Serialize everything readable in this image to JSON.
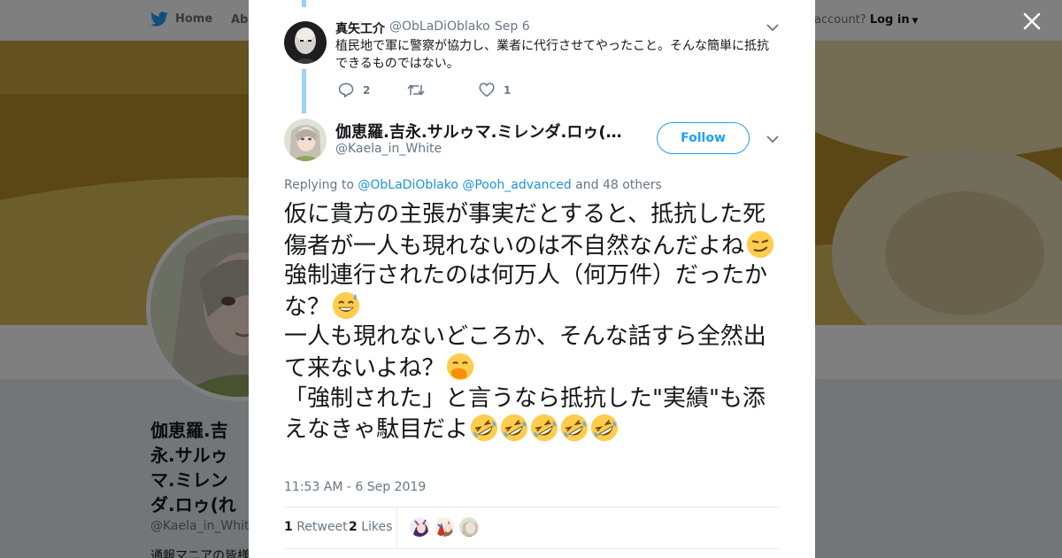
{
  "nav": {
    "home_label": "Home",
    "about_label": "Abo",
    "account_text": "account?",
    "login_label": "Log in"
  },
  "profile": {
    "name": "伽恵羅.吉永.サルゥマ.ミレンダ.ロゥ(れミ)☯お肉美透(CV:小清水",
    "handle": "@Kaela_in_White",
    "bio_snippet": "通報マニアの皆様"
  },
  "parent_tweet": {
    "name": "真矢工介",
    "handle": "@ObLaDiOblako",
    "date": "· Sep 6",
    "text": "植民地で軍に警察が協力し、業者に代行させてやったこと。そんな簡単に抵抗できるものではない。",
    "reply_count": "2",
    "retweet_count": "",
    "like_count": "1"
  },
  "main_tweet": {
    "name": "伽恵羅.吉永.サルゥマ.ミレンダ.ロゥ(…",
    "handle": "@Kaela_in_White",
    "follow_label": "Follow",
    "replying_prefix": "Replying to",
    "replying_user1": "@ObLaDiOblako",
    "replying_user2": "@Pooh_advanced",
    "replying_suffix": "and 48 others",
    "line1": "仮に貴方の主張が事実だとすると、抵抗した死傷者が一人も現れないのは不自然なんだよね",
    "line2": "強制連行されたのは何万人（何万件）だったかな？",
    "line3": "一人も現れないどころか、そんな話すら全然出て来ないよね？",
    "line4": "「強制された」と言うなら抵抗した\"実績\"も添えなきゃ駄目だよ",
    "timestamp": "11:53 AM - 6 Sep 2019",
    "retweets_count": "1",
    "retweets_label": "Retweet",
    "likes_count": "2",
    "likes_label": "Likes"
  },
  "icons": {
    "close": "close-icon",
    "twitter": "twitter-bird-icon",
    "reply": "reply-icon",
    "retweet": "retweet-icon",
    "like": "heart-icon",
    "chevron": "chevron-down-icon"
  },
  "colors": {
    "brand": "#1da1f2",
    "reply_thread": "#9ecff4",
    "link": "#1b95e0",
    "text_secondary": "#657786"
  }
}
